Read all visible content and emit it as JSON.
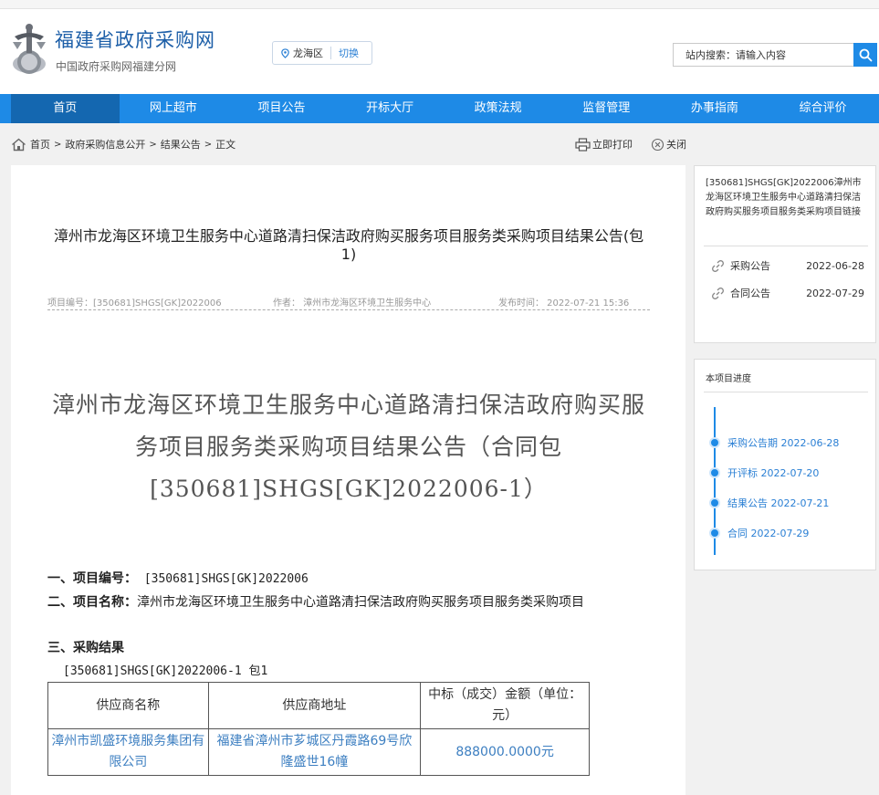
{
  "site": {
    "title": "福建省政府采购网",
    "subtitle": "中国政府采购网福建分网"
  },
  "region": {
    "name": "龙海区",
    "switch_label": "切换"
  },
  "search": {
    "label": "站内搜索：",
    "placeholder": "请输入内容"
  },
  "nav": [
    "首页",
    "网上超市",
    "项目公告",
    "开标大厅",
    "政策法规",
    "监督管理",
    "办事指南",
    "综合评价"
  ],
  "breadcrumb": {
    "home": "首页",
    "l1": "政府采购信息公开",
    "l2": "结果公告",
    "l3": "正文",
    "sep": ">"
  },
  "tools": {
    "print": "立即打印",
    "close": "关闭"
  },
  "doc": {
    "title": "漳州市龙海区环境卫生服务中心道路清扫保洁政府购买服务项目服务类采购项目结果公告(包1)",
    "meta_code": "项目编号：[350681]SHGS[GK]2022006",
    "meta_author": "作者：  漳州市龙海区环境卫生服务中心",
    "meta_time": "发布时间：  2022-07-21 15:36",
    "big_title": "漳州市龙海区环境卫生服务中心道路清扫保洁政府购买服务项目服务类采购项目结果公告（合同包[350681]SHGS[GK]2022006-1）",
    "sec1_label": "一、项目编号：",
    "sec1_value": " [350681]SHGS[GK]2022006",
    "sec2_label": "二、项目名称：",
    "sec2_value": "漳州市龙海区环境卫生服务中心道路清扫保洁政府购买服务项目服务类采购项目",
    "sec3_label": "三、采购结果",
    "package": "[350681]SHGS[GK]2022006-1 包1",
    "table_headers": [
      "供应商名称",
      "供应商地址",
      "中标（成交）金额（单位：元）"
    ],
    "table_rows": [
      [
        "漳州市凯盛环境服务集团有限公司",
        "福建省漳州市芗城区丹霞路69号欣隆盛世16幢",
        "888000.0000元"
      ]
    ]
  },
  "side": {
    "link_title": "[350681]SHGS[GK]2022006漳州市龙海区环境卫生服务中心道路清扫保洁政府购买服务项目服务类采购项目链接",
    "links": [
      {
        "name": "采购公告",
        "date": "2022-06-28"
      },
      {
        "name": "合同公告",
        "date": "2022-07-29"
      }
    ],
    "progress_title": "本项目进度",
    "progress": [
      "采购公告期 2022-06-28",
      "开评标 2022-07-20",
      "结果公告 2022-07-21",
      "合同 2022-07-29"
    ]
  },
  "colors": {
    "nav": "#1e8ae6",
    "nav_active": "#1467b0",
    "title": "#1d5fa8"
  }
}
